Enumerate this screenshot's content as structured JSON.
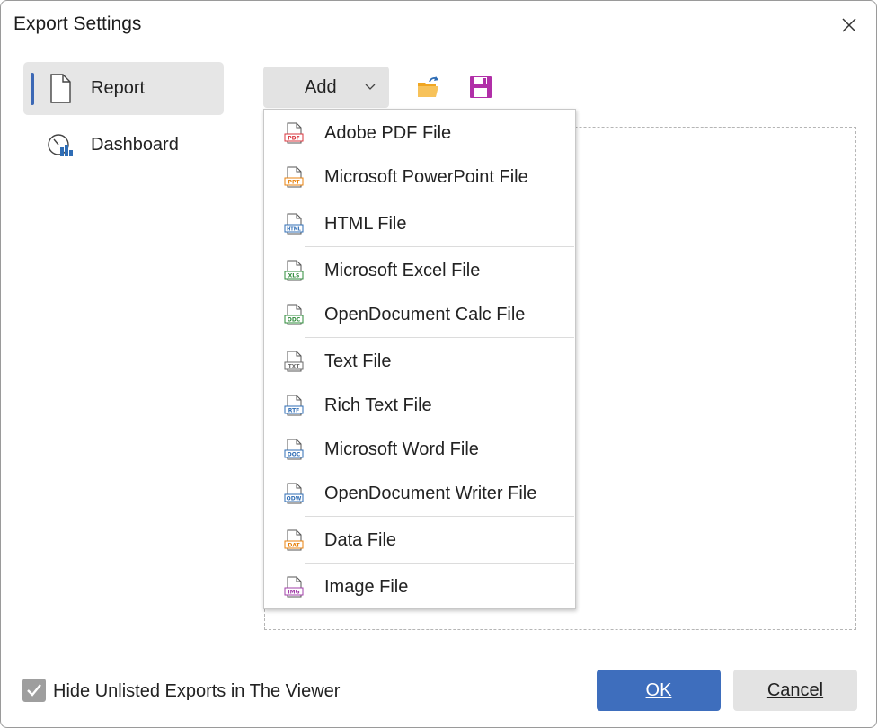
{
  "window": {
    "title": "Export Settings"
  },
  "sidebar": {
    "items": [
      {
        "label": "Report",
        "icon": "document-icon",
        "active": true
      },
      {
        "label": "Dashboard",
        "icon": "dashboard-icon",
        "active": false
      }
    ]
  },
  "toolbar": {
    "add_label": "Add",
    "open_icon": "open-folder-icon",
    "save_icon": "save-icon"
  },
  "menu": {
    "items": [
      {
        "label": "Adobe PDF File",
        "badge": "PDF",
        "color": "#d9363e"
      },
      {
        "label": "Microsoft PowerPoint File",
        "badge": "PPT",
        "color": "#e8820c"
      },
      {
        "label": "HTML File",
        "badge": "HTML",
        "color": "#2f6db5"
      },
      {
        "label": "Microsoft Excel File",
        "badge": "XLS",
        "color": "#2e8b3a"
      },
      {
        "label": "OpenDocument Calc File",
        "badge": "ODC",
        "color": "#2e8b3a"
      },
      {
        "label": "Text File",
        "badge": "TXT",
        "color": "#6b6b6b"
      },
      {
        "label": "Rich Text File",
        "badge": "RTF",
        "color": "#2f6db5"
      },
      {
        "label": "Microsoft Word File",
        "badge": "DOC",
        "color": "#2f6db5"
      },
      {
        "label": "OpenDocument Writer File",
        "badge": "ODW",
        "color": "#2f6db5"
      },
      {
        "label": "Data File",
        "badge": "DAT",
        "color": "#e8820c"
      },
      {
        "label": "Image File",
        "badge": "IMG",
        "color": "#a23fa8"
      }
    ]
  },
  "footer": {
    "checkbox_label": "Hide Unlisted Exports in The Viewer",
    "checkbox_checked": true,
    "ok_label": "OK",
    "cancel_label": "Cancel"
  },
  "colors": {
    "accent": "#3e6ebd",
    "save_icon": "#b12fa8",
    "folder_icon": "#f0a622"
  }
}
